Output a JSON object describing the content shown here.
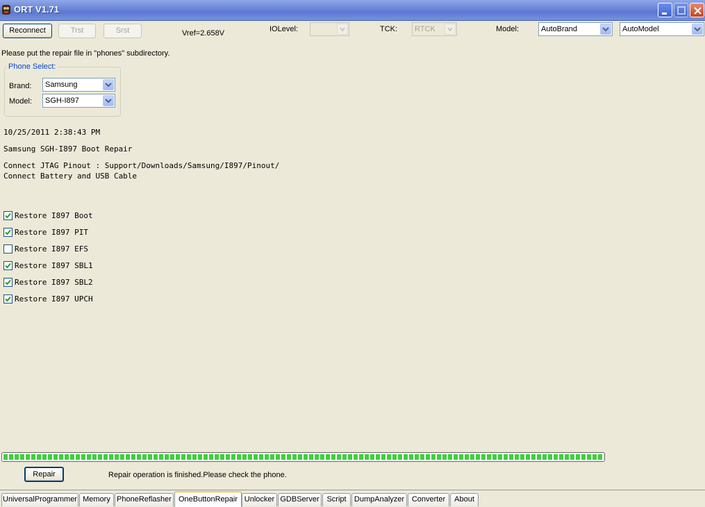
{
  "window": {
    "title": "ORT V1.71"
  },
  "toolbar": {
    "reconnect_label": "Reconnect",
    "trst_label": "Trst",
    "srst_label": "Srst",
    "vref_text": "Vref=2.658V",
    "iolevel_label": "IOLevel:",
    "iolevel_value": "",
    "tck_label": "TCK:",
    "tck_value": "RTCK",
    "model_label": "Model:",
    "brand_select_value": "AutoBrand",
    "model_select_value": "AutoModel"
  },
  "instructions": "Please put the repair file in \"phones\" subdirectory.",
  "phone_select": {
    "title": "Phone Select:",
    "brand_label": "Brand:",
    "brand_value": "Samsung",
    "model_label": "Model:",
    "model_value": "SGH-I897"
  },
  "log": {
    "timestamp": "10/25/2011 2:38:43 PM",
    "heading": "Samsung SGH-I897 Boot Repair",
    "line1": "Connect JTAG Pinout : Support/Downloads/Samsung/I897/Pinout/",
    "line2": "Connect Battery and USB Cable"
  },
  "options": [
    {
      "label": "Restore I897 Boot",
      "checked": true
    },
    {
      "label": "Restore I897 PIT",
      "checked": true
    },
    {
      "label": "Restore I897 EFS",
      "checked": false
    },
    {
      "label": "Restore I897 SBL1",
      "checked": true
    },
    {
      "label": "Restore I897 SBL2",
      "checked": true
    },
    {
      "label": "Restore I897 UPCH",
      "checked": true
    }
  ],
  "progress": {
    "percent": 100
  },
  "repair_button_label": "Repair",
  "status_text": "Repair operation is finished.Please check the phone.",
  "tabs": [
    {
      "label": "UniversalProgrammer",
      "active": false
    },
    {
      "label": "Memory",
      "active": false
    },
    {
      "label": "PhoneReflasher",
      "active": false
    },
    {
      "label": "OneButtonRepair",
      "active": true
    },
    {
      "label": "Unlocker",
      "active": false
    },
    {
      "label": "GDBServer",
      "active": false
    },
    {
      "label": "Script",
      "active": false
    },
    {
      "label": "DumpAnalyzer",
      "active": false
    },
    {
      "label": "Converter",
      "active": false
    },
    {
      "label": "About",
      "active": false
    }
  ],
  "colors": {
    "titlebar": "#5b78d1",
    "progress": "#3cd13c",
    "group_title": "#0046d5"
  }
}
